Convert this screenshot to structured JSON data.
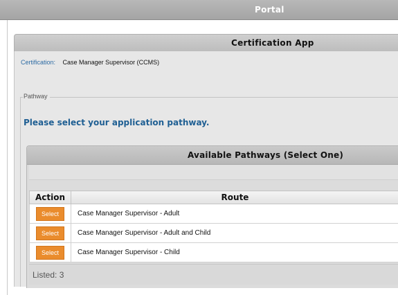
{
  "portal": {
    "title": "Portal"
  },
  "app": {
    "title": "Certification App"
  },
  "certification": {
    "label": "Certification:",
    "value": "Case Manager Supervisor (CCMS)"
  },
  "pathway": {
    "legend": "Pathway",
    "prompt": "Please select your application pathway.",
    "panel_title": "Available Pathways (Select One)",
    "columns": {
      "action": "Action",
      "route": "Route"
    },
    "rows": [
      {
        "button": "Select",
        "route": "Case Manager Supervisor - Adult"
      },
      {
        "button": "Select",
        "route": "Case Manager Supervisor - Adult and Child"
      },
      {
        "button": "Select",
        "route": "Case Manager Supervisor - Child"
      }
    ],
    "footer": "Listed: 3"
  },
  "colors": {
    "accent": "#ea8c2d",
    "link": "#1f5f93",
    "header": "#a4a4a4"
  }
}
